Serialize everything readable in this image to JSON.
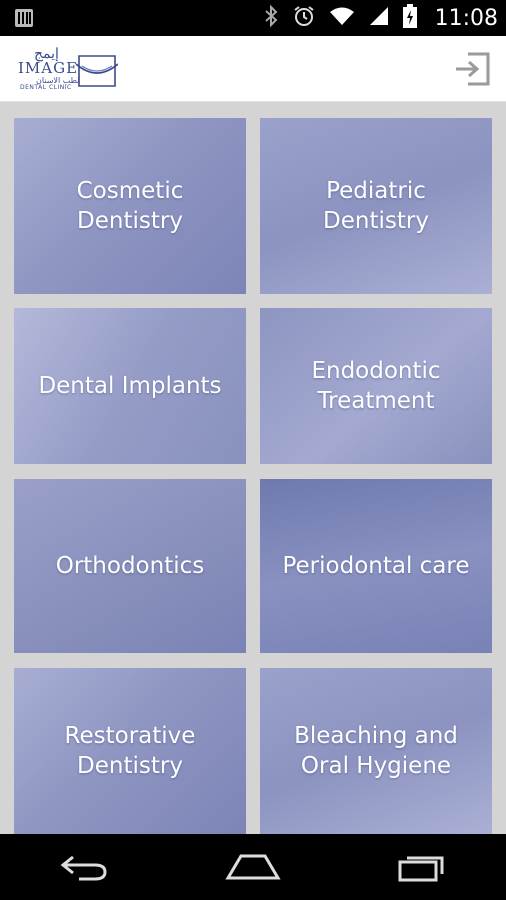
{
  "status_bar": {
    "time": "11:08",
    "icons": [
      "notification-icon",
      "bluetooth-icon",
      "alarm-icon",
      "wifi-icon",
      "signal-icon",
      "battery-charging-icon"
    ]
  },
  "header": {
    "logo_arabic": "إيمج",
    "logo_text": "IMAGE",
    "logo_arabic_sub": "لطب الاسنان",
    "logo_subtitle": "DENTAL CLINIC",
    "logo_icon": "tooth-smile-logo",
    "login_icon": "login-icon"
  },
  "services": [
    {
      "label": "Cosmetic\nDentistry",
      "bg": "#8f96c2"
    },
    {
      "label": "Pediatric\nDentistry",
      "bg": "#8c93c0"
    },
    {
      "label": "Dental Implants",
      "bg": "#959cc6"
    },
    {
      "label": "Endodontic\nTreatment",
      "bg": "#8e95c1"
    },
    {
      "label": "Orthodontics",
      "bg": "#8a91bd"
    },
    {
      "label": "Periodontal care",
      "bg": "#7f88b8"
    },
    {
      "label": "Restorative\nDentistry",
      "bg": "#8f96c2"
    },
    {
      "label": "Bleaching and\nOral Hygiene",
      "bg": "#8c93c0"
    }
  ],
  "nav": {
    "back_icon": "back-icon",
    "home_icon": "home-icon",
    "recents_icon": "recent-apps-icon"
  }
}
